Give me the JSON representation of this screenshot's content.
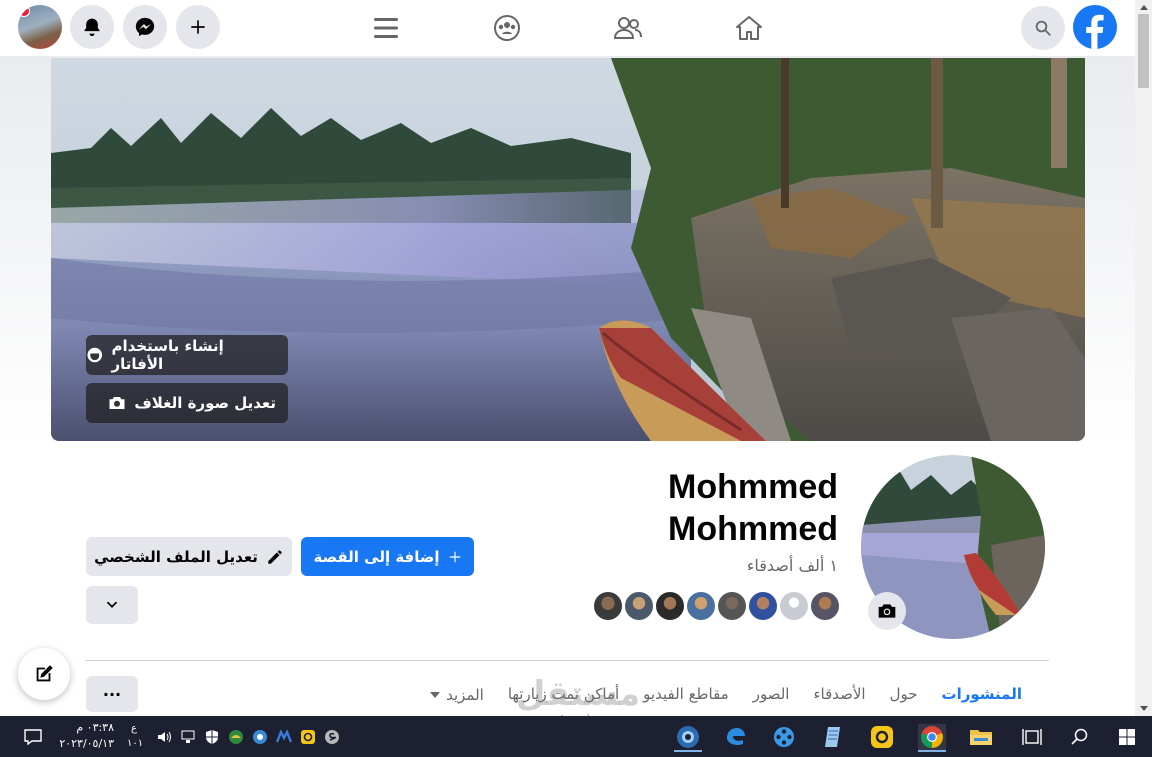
{
  "header": {
    "search_icon": "search-icon",
    "nav": [
      "home-icon",
      "friends-icon",
      "groups-icon",
      "menu-icon"
    ],
    "actions": [
      "add-icon",
      "messenger-icon",
      "notifications-icon"
    ]
  },
  "cover": {
    "avatar_button_label": "إنشاء باستخدام الأفاتار",
    "edit_cover_label": "تعديل صورة الغلاف"
  },
  "profile": {
    "name_line1": "Mohmmed",
    "name_line2": "Mohmmed",
    "friends_count": "١ ألف أصدقاء",
    "add_story_label": "إضافة إلى القصة",
    "edit_profile_label": "تعديل الملف الشخصي"
  },
  "tabs": [
    {
      "label": "المنشورات",
      "active": true
    },
    {
      "label": "حول"
    },
    {
      "label": "الأصدقاء"
    },
    {
      "label": "الصور"
    },
    {
      "label": "مقاطع الفيديو"
    },
    {
      "label": "أماكن تمت زيارتها"
    },
    {
      "label": "المزيد"
    }
  ],
  "more_dots": "···",
  "watermark": {
    "line1": "مستقل",
    "line2": "mostaql.com"
  },
  "taskbar": {
    "time": "٠٣:٣٨ م",
    "date": "٢٠٢٣/٠٥/١٣",
    "lang_top": "ع",
    "lang_bottom": "١٠١"
  },
  "colors": {
    "brand": "#1877f2",
    "taskbar": "#1c2030",
    "button_gray": "#e4e6eb"
  }
}
